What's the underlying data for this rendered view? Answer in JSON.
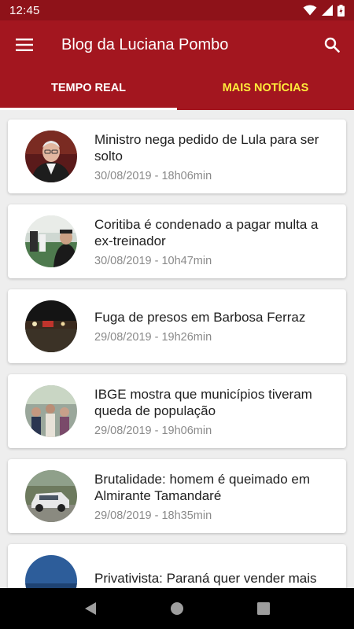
{
  "status_bar": {
    "time": "12:45"
  },
  "app_bar": {
    "title": "Blog da Luciana Pombo"
  },
  "tabs": [
    {
      "label": "TEMPO REAL"
    },
    {
      "label": "MAIS NOTÍCIAS"
    }
  ],
  "articles": [
    {
      "title": "Ministro nega pedido de Lula para ser solto",
      "date": "30/08/2019 - 18h06min"
    },
    {
      "title": "Coritiba é condenado a pagar multa a ex-treinador",
      "date": "30/08/2019 - 10h47min"
    },
    {
      "title": "Fuga de presos em Barbosa Ferraz",
      "date": "29/08/2019 - 19h26min"
    },
    {
      "title": "IBGE mostra que municípios tiveram queda de população",
      "date": "29/08/2019 - 19h06min"
    },
    {
      "title": "Brutalidade: homem é queimado em Almirante Tamandaré",
      "date": "29/08/2019 - 18h35min"
    },
    {
      "title": "Privativista: Paraná quer vender mais",
      "date": ""
    }
  ],
  "colors": {
    "primary": "#a3161f",
    "status": "#8e1219",
    "tab_inactive": "#ffeb3b"
  }
}
